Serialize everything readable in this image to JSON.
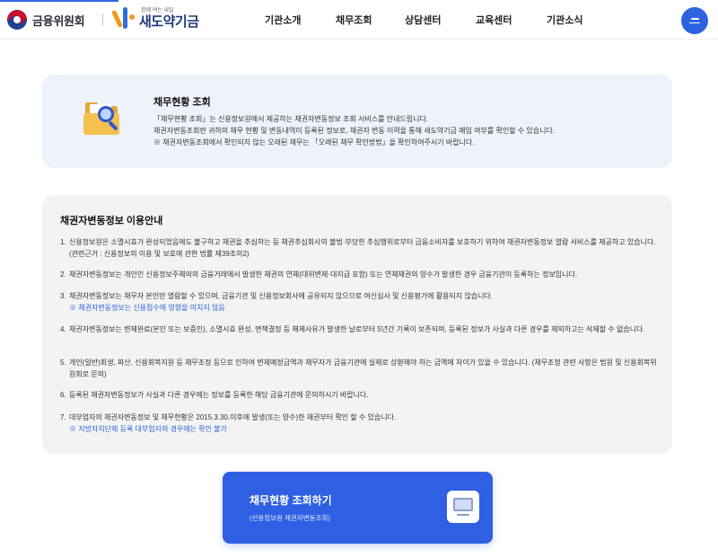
{
  "header": {
    "org_name": "금융위원회",
    "brand_tagline": "함께 여는 내일",
    "brand_name": "새도약기금",
    "nav": [
      "기관소개",
      "채무조회",
      "상담센터",
      "교육센터",
      "기관소식"
    ],
    "menu_icon": "hamburger-icon"
  },
  "intro": {
    "title": "채무현황 조회",
    "lines": [
      "「채무현황 조회」는 신용정보원에서 제공하는 채권자변동정보 조회 서비스를 안내드립니다.",
      "채권자변동조회란 귀하의 채무 현황 및 변동내역이 등록된 정보로, 채권자 변동 이력을 통해 새도약기금 매입 여부를 확인할 수 있습니다.",
      "※ 채권자변동조회에서 확인되지 않는 오래된 채무는 「오래된 채무 확인방법」을 확인하여주시기 바랍니다."
    ],
    "icon": "folder-search-icon"
  },
  "info": {
    "title": "채권자변동정보 이용안내",
    "items": [
      {
        "num": "1.",
        "text": "신용정보원은 소멸시효가 완성되었음에도 불구하고 채권을 추심하는 등 채권추심회사의 불법·부당한 추심행위로부터 금융소비자를 보호하기 위하여 채권자변동정보 열람 서비스를 제공하고 있습니다. (관련근거 : 신용정보의 이용 및 보호에 관한 법률 제39조의2)",
        "note": ""
      },
      {
        "num": "2.",
        "text": "채권자변동정보는 개인인 신용정보주체와의 금융거래에서 발생한 채권의 연체(대위변제·대지급 포함) 또는 연체채권의 양수가 발생한 경우 금융기관이 등록하는 정보입니다.",
        "note": ""
      },
      {
        "num": "3.",
        "text": "채권자변동정보는 채무자 본인만 열람할 수 있으며, 금융기관 및 신용정보회사에 공유되지 않으므로 여신심사 및 신용평가에 활용되지 않습니다.",
        "note": "※ 채권자변동정보는 신용점수에 영향을 미치지 않음"
      },
      {
        "num": "4.",
        "text": "채권자변동정보는 변제완료(본인 또는 보증인), 소멸시효 완성, 면책결정 등 해제사유가 발생한 날로부터 5년간 기록이 보존되며, 등록된 정보가 사실과 다른 경우를 제외하고는 삭제할 수 없습니다.",
        "note": ""
      },
      {
        "num": "5.",
        "text": "개인(일반)회생, 파산, 신용회복지원 등 채무조정 등으로 인하여 변제예정금액과 채무자가 금융기관에 실제로 상환해야 하는 금액에 차이가 있을 수 있습니다. (채무조정 관련 사항은 법원 및 신용회복위원회로 문의)",
        "note": ""
      },
      {
        "num": "6.",
        "text": "등록된 채권자변동정보가 사실과 다른 경우에는 정보를 등록한 해당 금융기관에 문의하시기 바랍니다.",
        "note": ""
      },
      {
        "num": "7.",
        "text": "대부업자의 채권자변동정보 및 채무현황은 2015.3.30.이후에 발생(또는 양수)한 채권부터 확인 할 수 있습니다.",
        "note": "※ 지방자치단체 등록 대부업자의 경우에는 확인 불가"
      }
    ]
  },
  "cta": {
    "title": "채무현황 조회하기",
    "subtitle": "(신용정보원 채권자변동조회)",
    "icon": "monitor-icon"
  },
  "colors": {
    "accent": "#2f5fe3",
    "intro_bg": "#eef2fb",
    "info_bg": "#f3f3f4",
    "note": "#2f63d6"
  }
}
